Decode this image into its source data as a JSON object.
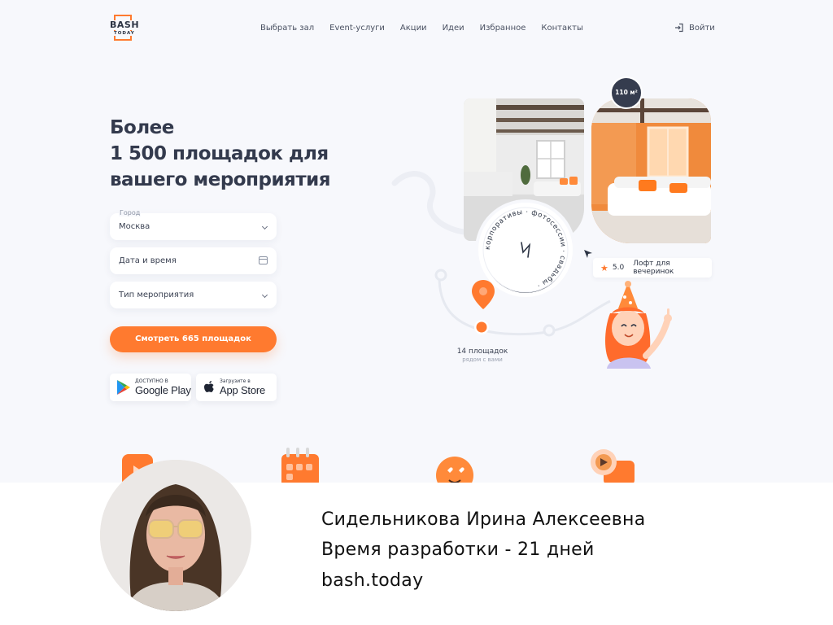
{
  "brand": {
    "logo_line1": "BASH",
    "logo_line2": "TODAY"
  },
  "nav": {
    "items": [
      "Выбрать зал",
      "Event-услуги",
      "Акции",
      "Идеи",
      "Избранное",
      "Контакты"
    ],
    "login_label": "Войти"
  },
  "hero": {
    "headline": [
      "Более",
      "1 500 площадок для",
      "вашего мероприятия"
    ]
  },
  "form": {
    "city_label": "Город",
    "city_value": "Москва",
    "datetime_placeholder": "Дата и время",
    "event_type_placeholder": "Тип мероприятия",
    "cta_label": "Смотреть 665 площадок"
  },
  "stores": {
    "google": {
      "small": "ДОСТУПНО В",
      "big": "Google Play"
    },
    "apple": {
      "small": "Загрузите в",
      "big": "App Store"
    }
  },
  "venue_card": {
    "area_badge": "110 м²",
    "rating": "5.0",
    "venue_name": "Лофт для вечеринок",
    "circle_text": "корпоративы · фотосессии · свадьбы ·"
  },
  "nearby": {
    "count_label": "14 площадок",
    "sub_label": "рядом с вами"
  },
  "credit": {
    "author": "Сидельникова Ирина Алексеевна",
    "duration": "Время разработки - 21 дней",
    "site": "bash.today"
  },
  "colors": {
    "accent": "#ff7a2f",
    "dark": "#333a4d",
    "hero_bg": "#f7f8fc"
  }
}
